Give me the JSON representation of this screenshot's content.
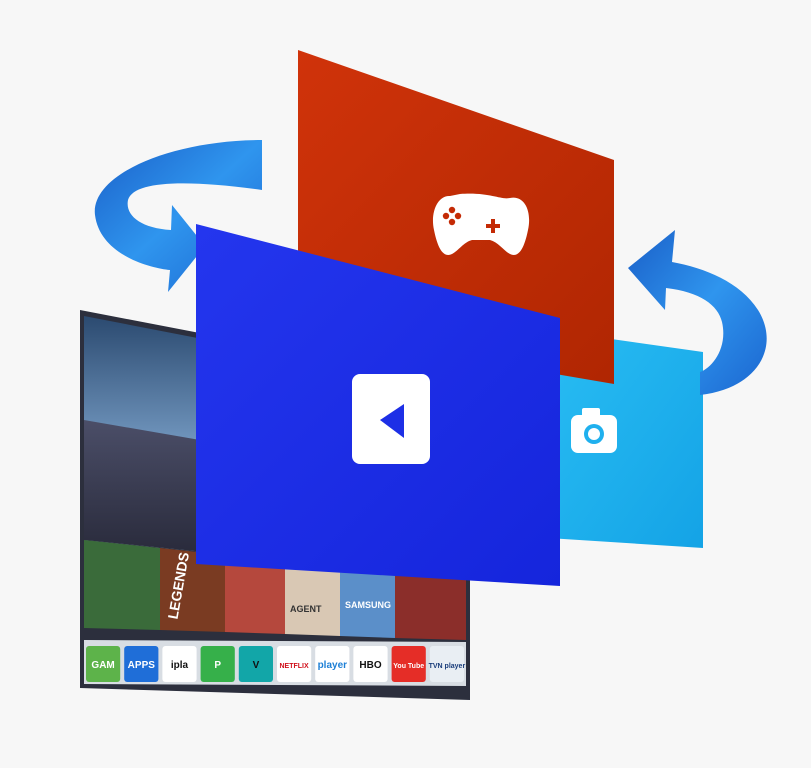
{
  "tv": {
    "content_row_labels": {
      "game_title": "LEGENDS",
      "tile_agent": "AGENT",
      "tile_samsung": "SAMSUNG"
    },
    "app_bar": [
      {
        "id": "games",
        "label": "GAM",
        "icon": "gamepad-icon",
        "bg": "#5db34a",
        "fg": "#ffffff"
      },
      {
        "id": "apps",
        "label": "APPS",
        "icon": "grid-icon",
        "bg": "#1f6ed8",
        "fg": "#ffffff"
      },
      {
        "id": "ipla",
        "label": "ipla",
        "icon": "",
        "bg": "#ffffff",
        "fg": "#111111"
      },
      {
        "id": "p",
        "label": "P",
        "icon": "",
        "bg": "#36b04a",
        "fg": "#ffffff"
      },
      {
        "id": "vod",
        "label": "V",
        "icon": "",
        "bg": "#12a6a8",
        "fg": "#111111"
      },
      {
        "id": "netflix",
        "label": "NETFLIX",
        "icon": "",
        "bg": "#ffffff",
        "fg": "#d0111c"
      },
      {
        "id": "player",
        "label": "player",
        "icon": "play-icon",
        "bg": "#ffffff",
        "fg": "#1c7fd6"
      },
      {
        "id": "hbo",
        "label": "HBO",
        "icon": "",
        "bg": "#ffffff",
        "fg": "#111111"
      },
      {
        "id": "youtube",
        "label": "You Tube",
        "icon": "",
        "bg": "#e52d27",
        "fg": "#ffffff"
      },
      {
        "id": "tvn",
        "label": "TVN player",
        "icon": "",
        "bg": "#e9eef3",
        "fg": "#1a3d7a"
      }
    ]
  },
  "panels": {
    "red": {
      "color": "#c42a05",
      "icon": "gamepad-icon"
    },
    "blue": {
      "color": "#1d2fe6",
      "icon": "play-icon"
    },
    "cyan": {
      "color": "#1fb0ee",
      "icon": "camera-icon"
    }
  },
  "arrows": {
    "color": "#1e7fe0",
    "icon": "rotate-arrow-icon"
  }
}
